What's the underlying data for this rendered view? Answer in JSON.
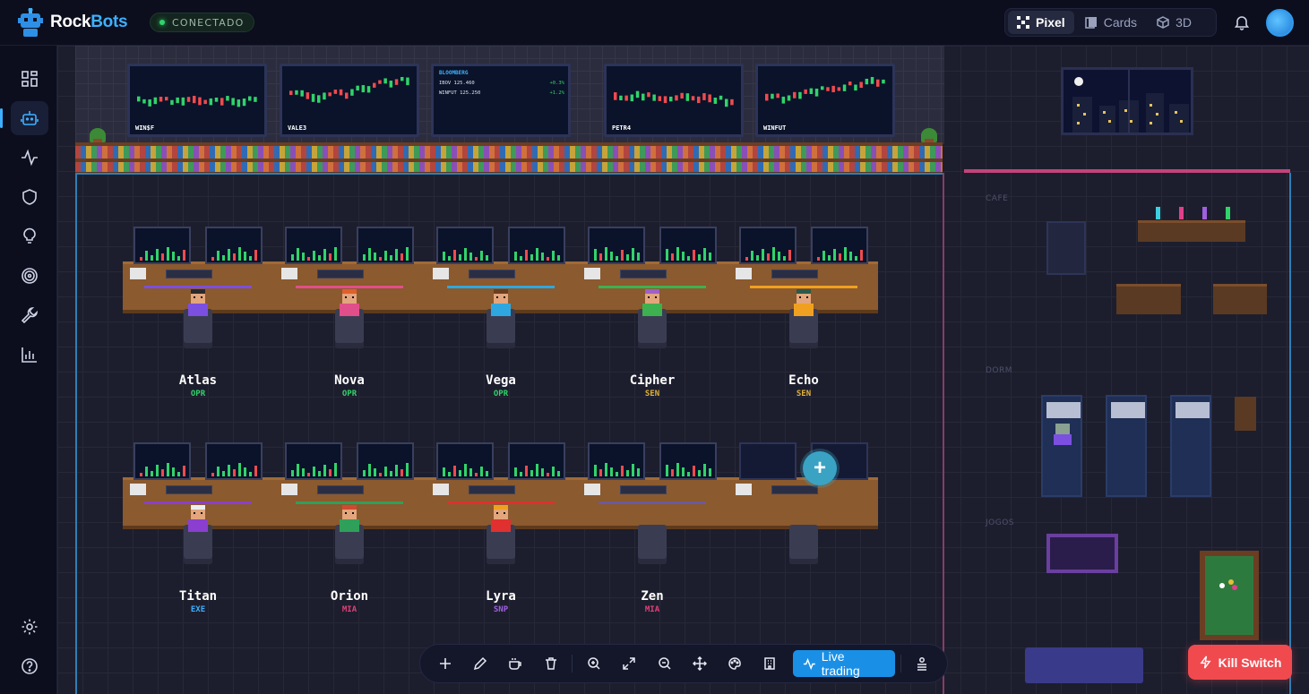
{
  "brand": {
    "name_part1": "Rock",
    "name_part2": "Bots",
    "logo_icon": "robot-logo-icon"
  },
  "connection": {
    "status": "CONECTADO",
    "color": "#31d36b"
  },
  "views": [
    {
      "label": "Pixel",
      "icon": "pixel-grid-icon",
      "active": true
    },
    {
      "label": "Cards",
      "icon": "cards-icon",
      "active": false
    },
    {
      "label": "3D",
      "icon": "cube-icon",
      "active": false
    }
  ],
  "sidebar": {
    "items": [
      {
        "icon": "dashboard-grid-icon",
        "active": false
      },
      {
        "icon": "robot-icon",
        "active": true
      },
      {
        "icon": "activity-pulse-icon",
        "active": false
      },
      {
        "icon": "shield-icon",
        "active": false
      },
      {
        "icon": "lightbulb-icon",
        "active": false
      },
      {
        "icon": "target-icon",
        "active": false
      },
      {
        "icon": "wrench-icon",
        "active": false
      },
      {
        "icon": "bar-chart-icon",
        "active": false
      }
    ],
    "bottom": [
      {
        "icon": "settings-gear-icon"
      },
      {
        "icon": "help-circle-icon"
      }
    ]
  },
  "wall_screens": [
    {
      "label": "WIN$F"
    },
    {
      "label": "VALE3"
    },
    {
      "label": "BLOOMBERG",
      "rows": [
        {
          "name": "IBOV 125.460",
          "change": "+0.3%"
        },
        {
          "name": "WINFUT 125.250",
          "change": "+1.2%"
        }
      ]
    },
    {
      "label": "PETR4"
    },
    {
      "label": "WINFUT"
    }
  ],
  "bots_row1": [
    {
      "name": "Atlas",
      "role": "OPR",
      "role_color": "#31d36b",
      "shirt": "#7b4fe0",
      "hair": "#2a2a2a",
      "line": "#7b4fe0"
    },
    {
      "name": "Nova",
      "role": "OPR",
      "role_color": "#31d36b",
      "shirt": "#e04f8a",
      "hair": "#e0602a",
      "line": "#e04f8a"
    },
    {
      "name": "Vega",
      "role": "OPR",
      "role_color": "#31d36b",
      "shirt": "#2ea7e0",
      "hair": "#6b3e1e",
      "line": "#2ea7e0"
    },
    {
      "name": "Cipher",
      "role": "SEN",
      "role_color": "#e0b23a",
      "shirt": "#3db04f",
      "hair": "#a060c8",
      "line": "#3db04f"
    },
    {
      "name": "Echo",
      "role": "SEN",
      "role_color": "#e0b23a",
      "shirt": "#f0a020",
      "hair": "#2a5a4a",
      "line": "#f0a020"
    }
  ],
  "bots_row2": [
    {
      "name": "Titan",
      "role": "EXE",
      "role_color": "#3db0ff",
      "shirt": "#8a3fd0",
      "hair": "#eeeeee",
      "line": "#8a3fd0"
    },
    {
      "name": "Orion",
      "role": "MIA",
      "role_color": "#e0407a",
      "shirt": "#2fa05a",
      "hair": "#d04a30",
      "line": "#2fa05a"
    },
    {
      "name": "Lyra",
      "role": "SNP",
      "role_color": "#a060e0",
      "shirt": "#e03030",
      "hair": "#f0a020",
      "line": "#e03030"
    },
    {
      "name": "Zen",
      "role": "MIA",
      "role_color": "#e0407a",
      "shirt": "#3a3d52",
      "hair": "#3a3d52",
      "line": "#6a5aa0",
      "empty_seat": true
    }
  ],
  "add_slot": {
    "icon": "plus-icon",
    "label": "+"
  },
  "rooms": {
    "cafe": "CAFE",
    "dorm": "DORM",
    "games": "JOGOS"
  },
  "toolbar": {
    "tools": [
      "plus-icon",
      "pencil-icon",
      "coffee-icon",
      "trash-icon",
      "zoom-in-icon",
      "fit-screen-icon",
      "zoom-out-icon",
      "move-icon",
      "palette-icon",
      "building-icon"
    ],
    "live_label": "Live trading",
    "live_icon": "activity-pulse-icon",
    "extra_icon": "layers-icon"
  },
  "kill_switch": {
    "label": "Kill Switch",
    "icon": "zap-icon",
    "color": "#f04a4f"
  }
}
